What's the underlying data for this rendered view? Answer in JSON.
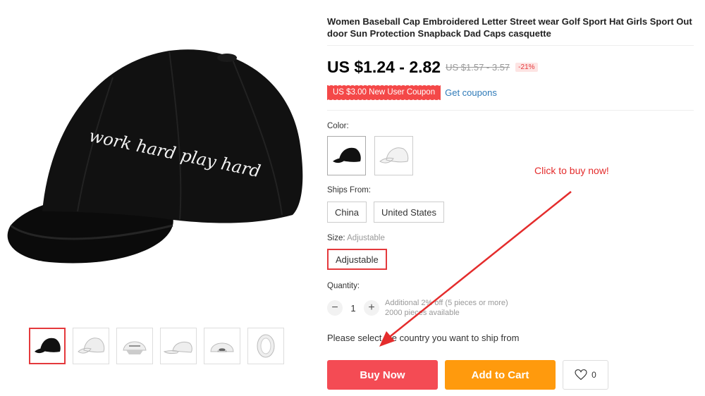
{
  "product": {
    "title": "Women Baseball Cap Embroidered Letter Street wear Golf Sport Hat Girls Sport Out door Sun Protection Snapback Dad Caps casquette",
    "embroidery_text": "work hard play hard",
    "price": "US $1.24 - 2.82",
    "original_price": "US $1.57 - 3.57",
    "discount": "-21%"
  },
  "coupon": {
    "badge": "US $3.00 New User Coupon",
    "link": "Get coupons"
  },
  "color": {
    "label": "Color:",
    "options": [
      "black-cap",
      "white-cap"
    ]
  },
  "ships_from": {
    "label": "Ships From:",
    "options": [
      "China",
      "United States"
    ]
  },
  "size": {
    "label": "Size:",
    "selected_value": "Adjustable",
    "options": [
      "Adjustable"
    ]
  },
  "quantity": {
    "label": "Quantity:",
    "value": "1",
    "minus": "−",
    "plus": "+",
    "discount_note": "Additional 2% off (5 pieces or more)",
    "available": "2000 pieces available"
  },
  "ship_note": "Please select the country you want to ship from",
  "actions": {
    "buy_now": "Buy Now",
    "add_to_cart": "Add to Cart",
    "wishlist_count": "0"
  },
  "annotation": "Click to buy now!",
  "colors": {
    "accent": "#f44b54",
    "cart": "#ff9a0d",
    "link": "#2e7ab8",
    "annotation": "#e42c2c"
  }
}
